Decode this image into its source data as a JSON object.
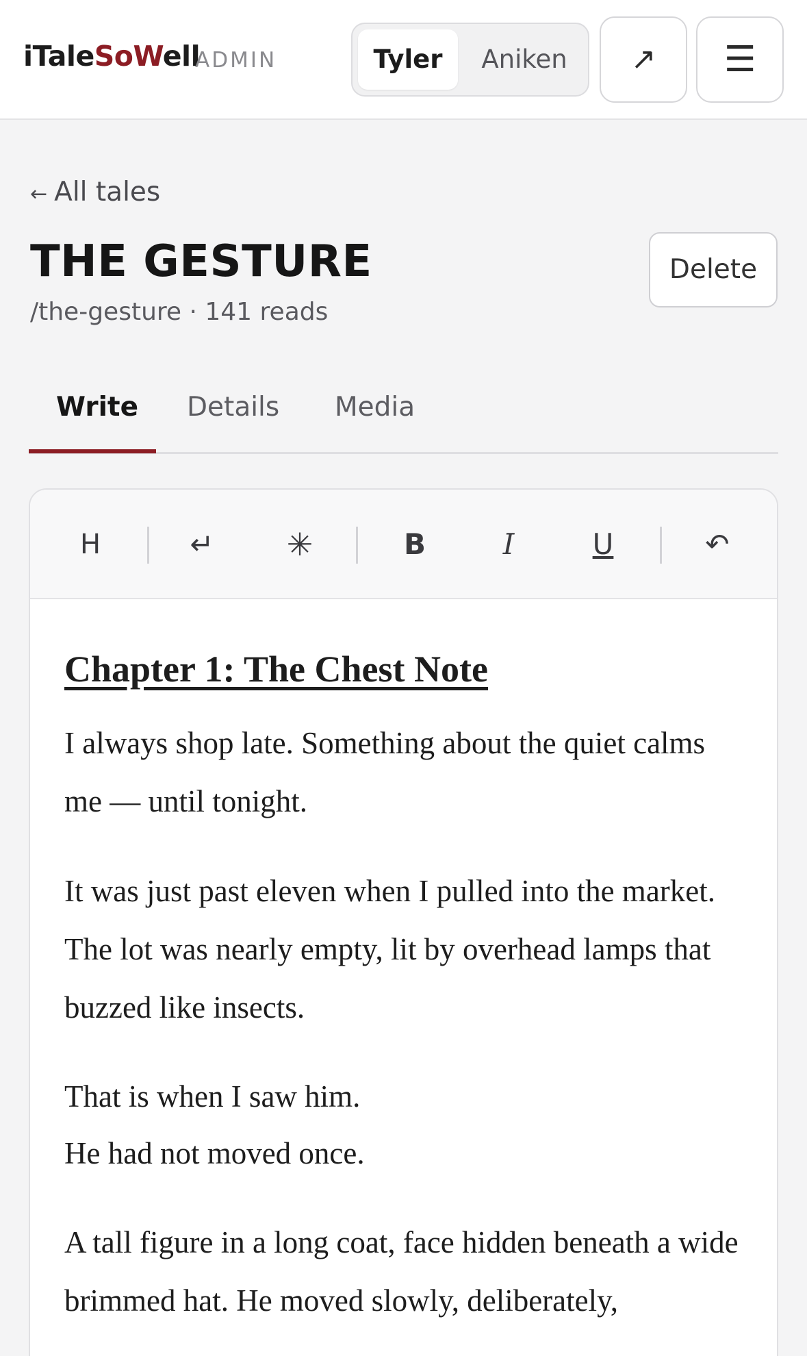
{
  "header": {
    "brand_plain_1": "i",
    "brand_plain_2": "Tale",
    "brand_accent_1": "So",
    "brand_accent_2": "W",
    "brand_plain_3": "ell",
    "admin_tag": "ADMIN",
    "user_switch": {
      "options": [
        "Tyler",
        "Aniken"
      ],
      "selected": "Tyler"
    },
    "open_external_icon": "↗",
    "menu_icon": "☰"
  },
  "page": {
    "back_label": "All tales",
    "back_arrow": "←",
    "title": "THE GESTURE",
    "meta": "/the-gesture · 141 reads",
    "delete_label": "Delete"
  },
  "tabs": [
    {
      "label": "Write",
      "active": true
    },
    {
      "label": "Details",
      "active": false
    },
    {
      "label": "Media",
      "active": false
    }
  ],
  "toolbar": {
    "heading": "H",
    "line_break": "↵",
    "separator_star": "✳",
    "bold": "B",
    "italic": "I",
    "underline": "U",
    "undo": "↶"
  },
  "document": {
    "chapter_heading": "Chapter 1: The Chest Note",
    "paragraphs": [
      "I always shop late. Something about the quiet calms me — until tonight.",
      "It was just past eleven when I pulled into the market. The lot was nearly empty, lit by overhead lamps that buzzed like insects.",
      "That is when I saw him.\nHe had not moved once.",
      "A tall figure in a long coat, face hidden beneath a wide brimmed hat. He moved slowly, deliberately,"
    ]
  },
  "colors": {
    "accent": "#8c1d24",
    "background": "#f4f4f5",
    "surface": "#ffffff"
  }
}
